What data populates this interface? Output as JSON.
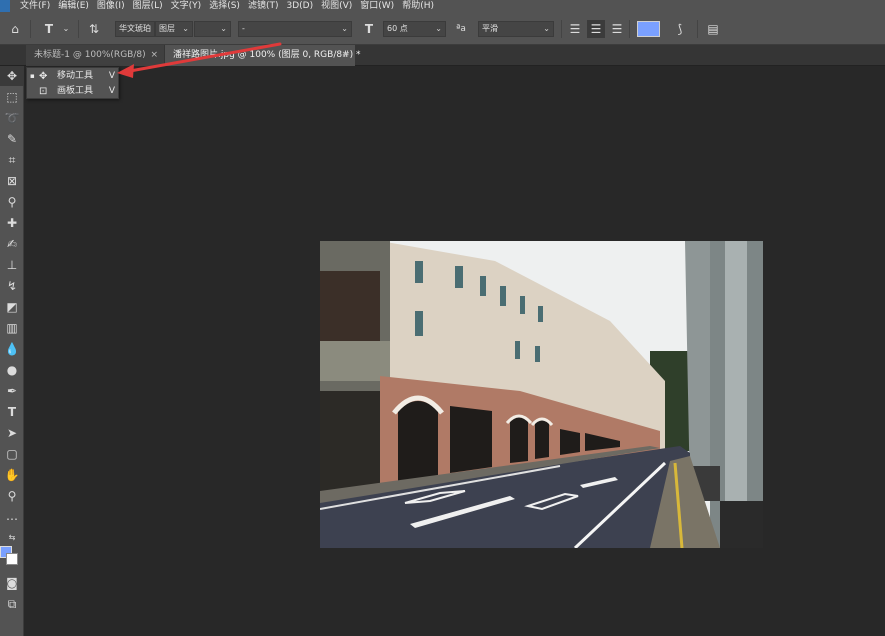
{
  "menu": {
    "items": [
      "文件(F)",
      "编辑(E)",
      "图像(I)",
      "图层(L)",
      "文字(Y)",
      "选择(S)",
      "滤镜(T)",
      "3D(D)",
      "视图(V)",
      "窗口(W)",
      "帮助(H)"
    ]
  },
  "options": {
    "font_family": "华文琥珀",
    "font_style": "图层",
    "font_size": "60 点",
    "anti_alias": "平滑",
    "leading": "-",
    "color_swatch": "#7aa0ff"
  },
  "tabs": [
    {
      "label": "未标题-1 @ 100%(RGB/8)",
      "close": "×"
    },
    {
      "label": "潘祥路图片.jpg @ 100% (图层 0, RGB/8#) *",
      "close": "×"
    }
  ],
  "flyout": {
    "items": [
      {
        "bullet": "▪",
        "label": "移动工具",
        "key": "V"
      },
      {
        "bullet": "",
        "label": "画板工具",
        "key": "V"
      }
    ]
  },
  "colors": {
    "arrow": "#e03a3a",
    "foreground": "#7aa0ff",
    "background": "#ffffff"
  },
  "icons": [
    "home-icon",
    "text-tool-icon",
    "vertical-text-icon",
    "font-size-icon",
    "anti-alias-icon",
    "align-left-icon",
    "align-center-icon",
    "align-right-icon",
    "warp-text-icon",
    "panel-icon"
  ]
}
